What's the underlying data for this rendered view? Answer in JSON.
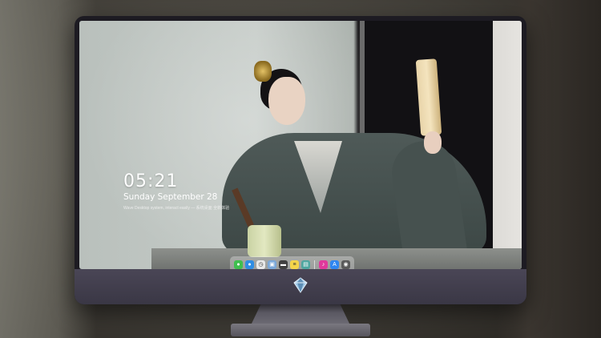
{
  "lockscreen": {
    "time": "05:21",
    "date": "Sunday September  28",
    "tagline": "Wave Desktop system, interact easily — 系统桌面 全新体验"
  },
  "dock": {
    "icons": [
      {
        "name": "messages-icon",
        "glyph": "●",
        "color": "#3fbf4f"
      },
      {
        "name": "finder-icon",
        "glyph": "●",
        "color": "#2f8de4"
      },
      {
        "name": "clock-icon",
        "glyph": "◷",
        "color": "#e9e9e9"
      },
      {
        "name": "photos-icon",
        "glyph": "▣",
        "color": "#7aa7d8"
      },
      {
        "name": "clapper-icon",
        "glyph": "▬",
        "color": "#404040"
      },
      {
        "name": "notes-icon",
        "glyph": "≡",
        "color": "#f4d54a"
      },
      {
        "name": "image-viewer-icon",
        "glyph": "▤",
        "color": "#4fa6a0"
      },
      {
        "name": "music-icon",
        "glyph": "♪",
        "color": "#e0399b"
      },
      {
        "name": "app-store-icon",
        "glyph": "A",
        "color": "#2f86f0"
      },
      {
        "name": "camera-icon",
        "glyph": "◉",
        "color": "#5a5a5a"
      }
    ]
  },
  "monitor": {
    "logo": "gem-logo-icon"
  }
}
